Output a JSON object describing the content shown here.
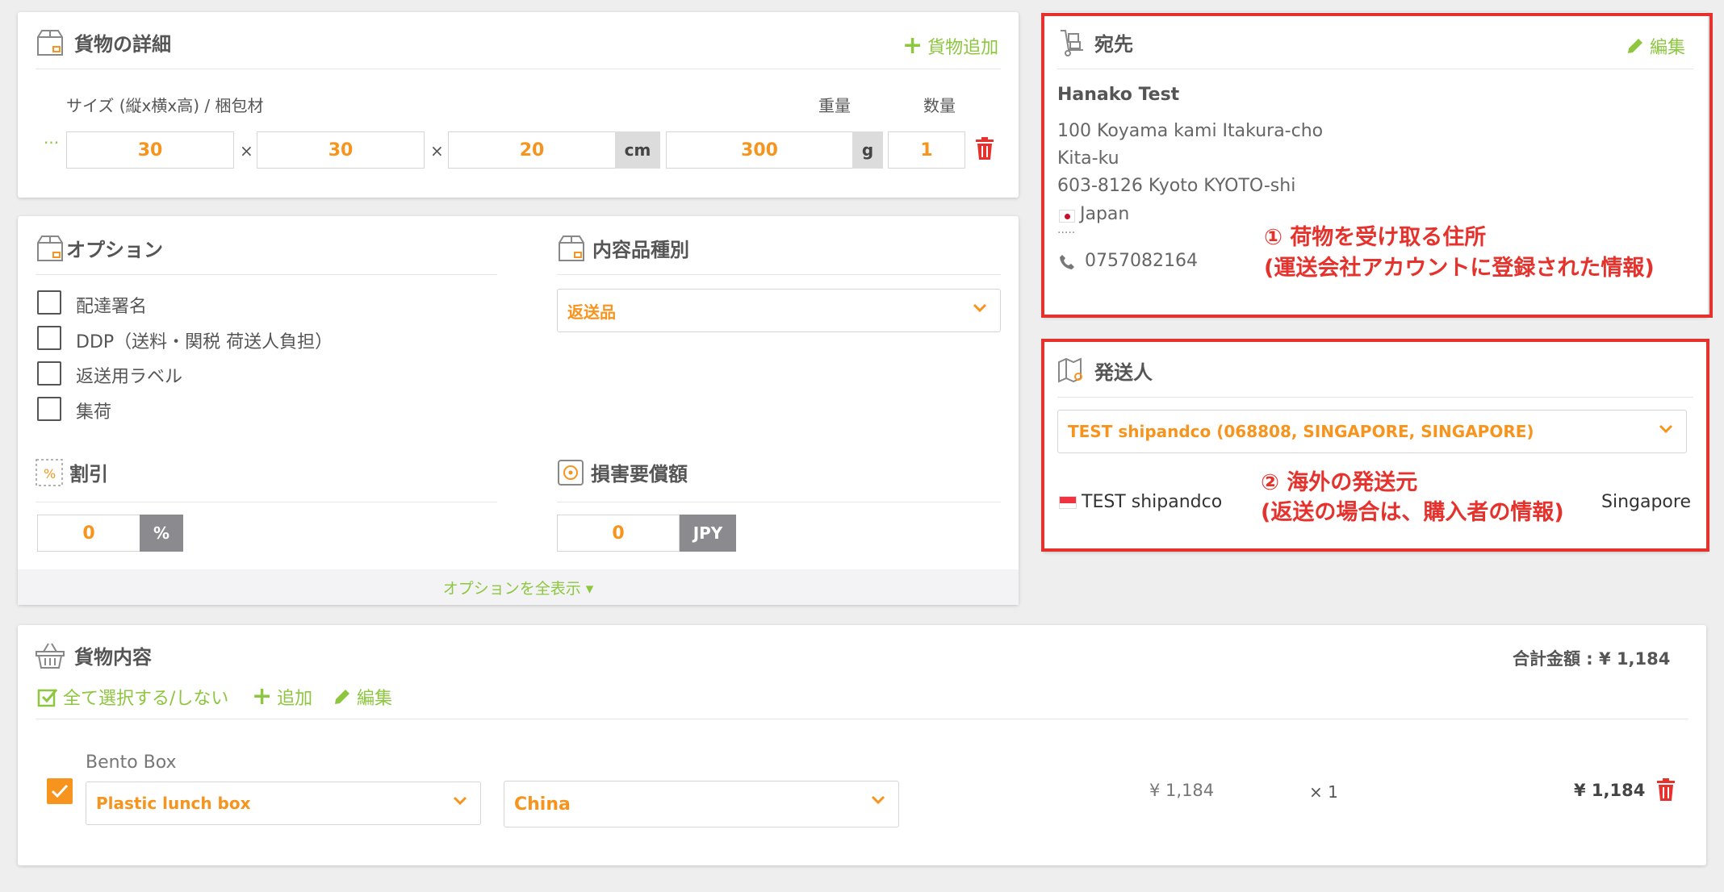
{
  "cargo": {
    "title": "貨物の詳細",
    "add_label": "貨物追加",
    "size_label": "サイズ (縦x横x高) / 梱包材",
    "weight_label": "重量",
    "qty_label": "数量",
    "dots": "···",
    "length": "30",
    "width": "30",
    "height": "20",
    "times": "×",
    "dim_unit": "cm",
    "weight": "300",
    "weight_unit": "g",
    "qty": "1"
  },
  "options": {
    "title": "オプション",
    "items": [
      "配達署名",
      "DDP（送料・関税 荷送人負担）",
      "返送用ラベル",
      "集荷"
    ],
    "content_type_title": "内容品種別",
    "content_type_value": "返送品",
    "discount_title": "割引",
    "discount_value": "0",
    "discount_unit": "%",
    "damage_title": "損害要償額",
    "damage_value": "0",
    "damage_unit": "JPY",
    "show_all": "オプションを全表示 ▾"
  },
  "destination": {
    "title": "宛先",
    "edit_label": "編集",
    "name": "Hanako Test",
    "line1": "100 Koyama kami Itakura-cho",
    "line2": "Kita-ku",
    "line3": "603-8126 Kyoto KYOTO-shi",
    "country": "Japan",
    "sep": "·····",
    "phone": "0757082164",
    "annotation_line1": "① 荷物を受け取る住所",
    "annotation_line2": "(運送会社アカウントに登録された情報)"
  },
  "sender": {
    "title": "発送人",
    "select_value": "TEST shipandco (068808, SINGAPORE, SINGAPORE)",
    "name": "TEST shipandco",
    "country": "Singapore",
    "annotation_line1": "② 海外の発送元",
    "annotation_line2": "(返送の場合は、購入者の情報)"
  },
  "contents": {
    "title": "貨物内容",
    "total_label": "合計金額 : ¥ 1,184",
    "select_all": "全て選択する/しない",
    "add": "追加",
    "edit": "編集",
    "item": {
      "name": "Bento Box",
      "category": "Plastic lunch box",
      "origin": "China",
      "unit_price": "¥ 1,184",
      "qty": "× 1",
      "total": "¥ 1,184"
    }
  },
  "colors": {
    "accent_green": "#8dc63f",
    "accent_orange": "#f7941d",
    "alert_red": "#e5322d"
  }
}
